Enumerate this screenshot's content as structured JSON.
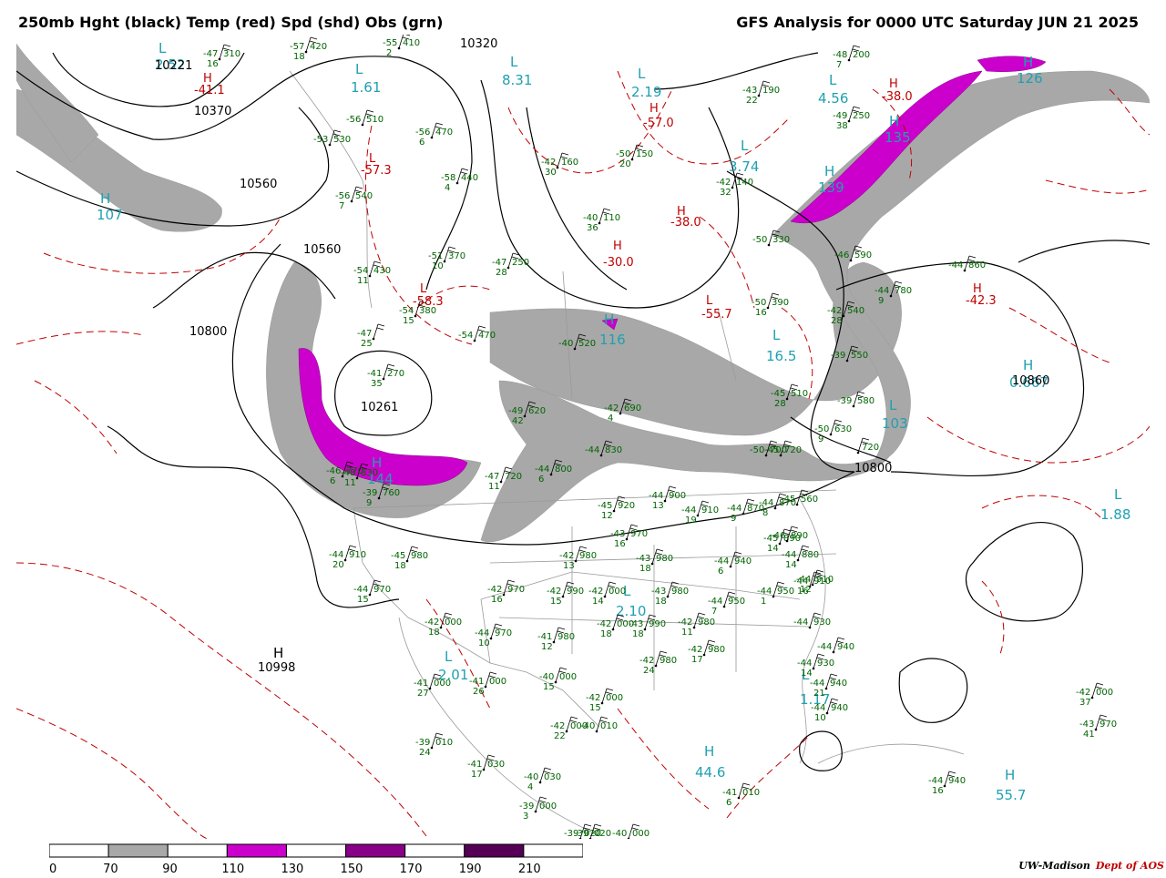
{
  "title": {
    "left": "250mb Hght (black) Temp (red) Spd (shd) Obs (grn)",
    "right": "GFS Analysis for 0000 UTC Saturday  JUN 21 2025"
  },
  "colors": {
    "height_contour": "#000000",
    "temperature_contour": "#c00000",
    "speed_70_90": "#a8a8a8",
    "speed_110_130": "#cc00cc",
    "speed_150_170": "#880088",
    "speed_190_210": "#550055",
    "observations": "#006400",
    "extrema_labels": "#20a0b0",
    "borders": "#9a9a9a"
  },
  "height_labels": [
    {
      "text": "10320"
    },
    {
      "text": "10560"
    },
    {
      "text": "10560"
    },
    {
      "text": "10800"
    },
    {
      "text": "10261"
    },
    {
      "text": "10998"
    },
    {
      "text": "10800"
    },
    {
      "text": "10860"
    },
    {
      "text": "10221"
    },
    {
      "text": "10370"
    }
  ],
  "extrema": [
    {
      "type": "H",
      "value": "107"
    },
    {
      "type": "H",
      "value": "144"
    },
    {
      "type": "H",
      "value": "116"
    },
    {
      "type": "H",
      "value": "135"
    },
    {
      "type": "H",
      "value": "139"
    },
    {
      "type": "H",
      "value": "126"
    },
    {
      "type": "L",
      "value": "2.52"
    },
    {
      "type": "L",
      "value": "1.61"
    },
    {
      "type": "L",
      "value": "8.31"
    },
    {
      "type": "L",
      "value": "2.19"
    },
    {
      "type": "L",
      "value": "4.56"
    },
    {
      "type": "L",
      "value": "3.74"
    },
    {
      "type": "L",
      "value": "16.5"
    },
    {
      "type": "L",
      "value": "2.10"
    },
    {
      "type": "L",
      "value": "2.01"
    },
    {
      "type": "L",
      "value": "1.17"
    },
    {
      "type": "L",
      "value": "1.88"
    },
    {
      "type": "H",
      "value": "44.6"
    },
    {
      "type": "H",
      "value": "55.7"
    },
    {
      "type": "H",
      "value": "0.667"
    },
    {
      "type": "L",
      "value": "103"
    }
  ],
  "temperature_labels": [
    {
      "type": "H",
      "value": "-41.1"
    },
    {
      "type": "L",
      "value": "-57.3"
    },
    {
      "type": "L",
      "value": "-58.3"
    },
    {
      "type": "H",
      "value": "-57.0"
    },
    {
      "type": "H",
      "value": "-30.0"
    },
    {
      "type": "H",
      "value": "-38.0"
    },
    {
      "type": "L",
      "value": "-55.7"
    },
    {
      "type": "H",
      "value": "-42.3"
    },
    {
      "type": "H",
      "value": "-38.0"
    }
  ],
  "observations": [
    {
      "t": "-47",
      "h": "310",
      "d": "16"
    },
    {
      "t": "-57",
      "h": "420",
      "d": "18"
    },
    {
      "t": "-55",
      "h": "410",
      "d": "2"
    },
    {
      "t": "-56",
      "h": "510",
      "d": ""
    },
    {
      "t": "-53",
      "h": "530",
      "d": ""
    },
    {
      "t": "-56",
      "h": "470",
      "d": "6"
    },
    {
      "t": "-56",
      "h": "540",
      "d": "7"
    },
    {
      "t": "-58",
      "h": "440",
      "d": "4"
    },
    {
      "t": "-51",
      "h": "370",
      "d": "10"
    },
    {
      "t": "-47",
      "h": "250",
      "d": "28"
    },
    {
      "t": "-54",
      "h": "430",
      "d": "11"
    },
    {
      "t": "-54",
      "h": "380",
      "d": "15"
    },
    {
      "t": "-47",
      "h": "",
      "d": "25"
    },
    {
      "t": "-41",
      "h": "270",
      "d": "35"
    },
    {
      "t": "-54",
      "h": "470",
      "d": ""
    },
    {
      "t": "-49",
      "h": "620",
      "d": "42"
    },
    {
      "t": "-40",
      "h": "520",
      "d": ""
    },
    {
      "t": "-42",
      "h": "160",
      "d": "30"
    },
    {
      "t": "-50",
      "h": "150",
      "d": "20"
    },
    {
      "t": "-42",
      "h": "140",
      "d": "32"
    },
    {
      "t": "-40",
      "h": "110",
      "d": "36"
    },
    {
      "t": "-43",
      "h": "190",
      "d": "22"
    },
    {
      "t": "-49",
      "h": "250",
      "d": "38"
    },
    {
      "t": "-48",
      "h": "200",
      "d": "7"
    },
    {
      "t": "-50",
      "h": "330",
      "d": ""
    },
    {
      "t": "-46",
      "h": "590",
      "d": ""
    },
    {
      "t": "-44",
      "h": "860",
      "d": ""
    },
    {
      "t": "-44",
      "h": "780",
      "d": "9"
    },
    {
      "t": "-42",
      "h": "540",
      "d": "28"
    },
    {
      "t": "-50",
      "h": "390",
      "d": "16"
    },
    {
      "t": "-39",
      "h": "550",
      "d": ""
    },
    {
      "t": "-45",
      "h": "510",
      "d": "28"
    },
    {
      "t": "-39",
      "h": "580",
      "d": ""
    },
    {
      "t": "-50",
      "h": "630",
      "d": "9"
    },
    {
      "t": "",
      "h": "720",
      "d": ""
    },
    {
      "t": "-47",
      "h": "720",
      "d": "11"
    },
    {
      "t": "-44",
      "h": "800",
      "d": "6"
    },
    {
      "t": "-44",
      "h": "830",
      "d": ""
    },
    {
      "t": "-45",
      "h": "920",
      "d": "12"
    },
    {
      "t": "-44",
      "h": "900",
      "d": "13"
    },
    {
      "t": "-44",
      "h": "910",
      "d": "19"
    },
    {
      "t": "-44",
      "h": "870",
      "d": "9"
    },
    {
      "t": "-44",
      "h": "870",
      "d": "8"
    },
    {
      "t": "-43",
      "h": "970",
      "d": "16"
    },
    {
      "t": "-42",
      "h": "980",
      "d": "13"
    },
    {
      "t": "-43",
      "h": "980",
      "d": "18"
    },
    {
      "t": "-44",
      "h": "940",
      "d": "6"
    },
    {
      "t": "-44",
      "h": "910",
      "d": "20"
    },
    {
      "t": "-45",
      "h": "980",
      "d": "18"
    },
    {
      "t": "-44",
      "h": "970",
      "d": "15"
    },
    {
      "t": "-42",
      "h": "970",
      "d": "16"
    },
    {
      "t": "-42",
      "h": "990",
      "d": "15"
    },
    {
      "t": "-42",
      "h": "000",
      "d": "14"
    },
    {
      "t": "-43",
      "h": "980",
      "d": "18"
    },
    {
      "t": "-44",
      "h": "950",
      "d": "7"
    },
    {
      "t": "-44",
      "h": "950",
      "d": "1"
    },
    {
      "t": "-44",
      "h": "910",
      "d": "16"
    },
    {
      "t": "-42",
      "h": "000",
      "d": "18"
    },
    {
      "t": "-44",
      "h": "970",
      "d": "10"
    },
    {
      "t": "-41",
      "h": "980",
      "d": "12"
    },
    {
      "t": "-42",
      "h": "000",
      "d": "18"
    },
    {
      "t": "-43",
      "h": "990",
      "d": "18"
    },
    {
      "t": "-42",
      "h": "980",
      "d": "11"
    },
    {
      "t": "-44",
      "h": "930",
      "d": ""
    },
    {
      "t": "-44",
      "h": "940",
      "d": ""
    },
    {
      "t": "-42",
      "h": "980",
      "d": "24"
    },
    {
      "t": "-42",
      "h": "980",
      "d": "17"
    },
    {
      "t": "-41",
      "h": "000",
      "d": "27"
    },
    {
      "t": "-41",
      "h": "000",
      "d": "26"
    },
    {
      "t": "-40",
      "h": "000",
      "d": "15"
    },
    {
      "t": "-42",
      "h": "000",
      "d": "15"
    },
    {
      "t": "-42",
      "h": "000",
      "d": "22"
    },
    {
      "t": "-40",
      "h": "010",
      "d": ""
    },
    {
      "t": "-39",
      "h": "010",
      "d": "24"
    },
    {
      "t": "-41",
      "h": "030",
      "d": "17"
    },
    {
      "t": "-40",
      "h": "030",
      "d": "4"
    },
    {
      "t": "-39",
      "h": "000",
      "d": "3"
    },
    {
      "t": "-39",
      "h": "020",
      "d": ""
    },
    {
      "t": "-40",
      "h": "000",
      "d": ""
    },
    {
      "t": "-39",
      "h": "020",
      "d": ""
    },
    {
      "t": "-41",
      "h": "010",
      "d": "6"
    },
    {
      "t": "-44",
      "h": "930",
      "d": "14"
    },
    {
      "t": "-44",
      "h": "940",
      "d": "21"
    },
    {
      "t": "-44",
      "h": "940",
      "d": "10"
    },
    {
      "t": "-42",
      "h": "000",
      "d": "37"
    },
    {
      "t": "-43",
      "h": "970",
      "d": "41"
    },
    {
      "t": "-44",
      "h": "940",
      "d": "16"
    },
    {
      "t": "-44",
      "h": "880",
      "d": "14"
    },
    {
      "t": "-45",
      "h": "890",
      "d": "14"
    },
    {
      "t": "-46",
      "h": "890",
      "d": ""
    },
    {
      "t": "-45",
      "h": "560",
      "d": ""
    },
    {
      "t": "-44",
      "h": "910",
      "d": "12"
    },
    {
      "t": "-45",
      "h": "720",
      "d": ""
    },
    {
      "t": "-42",
      "h": "690",
      "d": "4"
    },
    {
      "t": "-50",
      "h": "700",
      "d": ""
    },
    {
      "t": "-39",
      "h": "760",
      "d": "9"
    },
    {
      "t": "-48",
      "h": "830",
      "d": "11"
    },
    {
      "t": "-46",
      "h": "770",
      "d": "6"
    }
  ],
  "colorbar": {
    "ticks": [
      "0",
      "70",
      "90",
      "110",
      "130",
      "150",
      "170",
      "190",
      "210"
    ],
    "segments": [
      "#ffffff",
      "#a8a8a8",
      "#ffffff",
      "#cc00cc",
      "#ffffff",
      "#880088",
      "#ffffff",
      "#550055",
      "#ffffff"
    ]
  },
  "credit": {
    "org": "UW-Madison",
    "dept": "Dept of AOS"
  }
}
